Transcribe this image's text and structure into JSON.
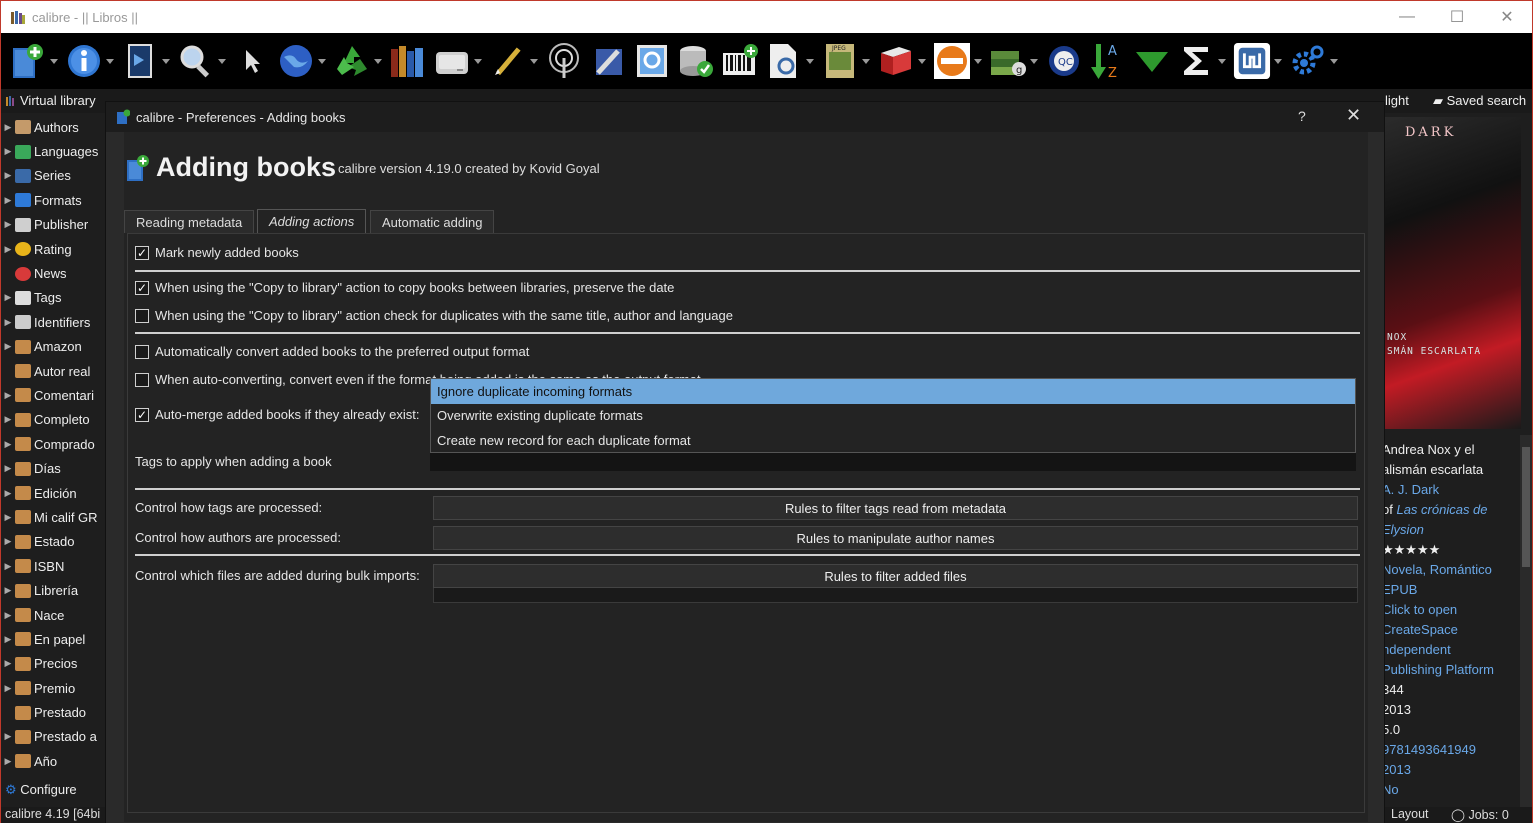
{
  "window": {
    "title": "calibre - || Libros ||",
    "min": "—",
    "max": "☐",
    "close": "✕"
  },
  "toolbar": {
    "items": [
      "add-books",
      "edit-metadata",
      "convert-books",
      "view",
      "choose-library",
      "remove-books",
      "library",
      "device",
      "edit-book",
      "fetch-news",
      "save-to-disk",
      "connect-share",
      "tweak",
      "preferences",
      "check-library",
      "barcode",
      "search-docs",
      "epub",
      "bookshelf",
      "rating",
      "goodreads",
      "quality-check",
      "sort",
      "filter",
      "sum",
      "connect",
      "settings"
    ]
  },
  "search_row": {
    "virtual_library": "Virtual library",
    "highlight": "light",
    "saved_search": "Saved search"
  },
  "tag_browser": {
    "items": [
      {
        "label": "Authors",
        "arrow": true,
        "icon": "authors-icon"
      },
      {
        "label": "Languages",
        "arrow": true,
        "icon": "languages-icon"
      },
      {
        "label": "Series",
        "arrow": true,
        "icon": "series-icon"
      },
      {
        "label": "Formats",
        "arrow": true,
        "icon": "formats-icon"
      },
      {
        "label": "Publisher",
        "arrow": true,
        "icon": "publisher-icon"
      },
      {
        "label": "Rating",
        "arrow": true,
        "icon": "rating-icon"
      },
      {
        "label": "News",
        "arrow": false,
        "icon": "news-icon"
      },
      {
        "label": "Tags",
        "arrow": true,
        "icon": "tags-icon"
      },
      {
        "label": "Identifiers",
        "arrow": true,
        "icon": "identifiers-icon"
      },
      {
        "label": "Amazon",
        "arrow": true,
        "icon": "column-icon"
      },
      {
        "label": "Autor real",
        "arrow": false,
        "icon": "column-icon"
      },
      {
        "label": "Comentari",
        "arrow": true,
        "icon": "column-icon"
      },
      {
        "label": "Completo",
        "arrow": true,
        "icon": "column-icon"
      },
      {
        "label": "Comprado",
        "arrow": true,
        "icon": "column-icon"
      },
      {
        "label": "Días",
        "arrow": true,
        "icon": "column-icon"
      },
      {
        "label": "Edición",
        "arrow": true,
        "icon": "column-icon"
      },
      {
        "label": "Mi calif GR",
        "arrow": true,
        "icon": "column-icon"
      },
      {
        "label": "Estado",
        "arrow": true,
        "icon": "column-icon"
      },
      {
        "label": "ISBN",
        "arrow": true,
        "icon": "column-icon"
      },
      {
        "label": "Librería",
        "arrow": true,
        "icon": "column-icon"
      },
      {
        "label": "Nace",
        "arrow": true,
        "icon": "column-icon"
      },
      {
        "label": "En papel",
        "arrow": true,
        "icon": "column-icon"
      },
      {
        "label": "Precios",
        "arrow": true,
        "icon": "column-icon"
      },
      {
        "label": "Premio",
        "arrow": true,
        "icon": "column-icon"
      },
      {
        "label": "Prestado",
        "arrow": false,
        "icon": "column-icon"
      },
      {
        "label": "Prestado a",
        "arrow": true,
        "icon": "column-icon"
      },
      {
        "label": "Año",
        "arrow": true,
        "icon": "column-icon"
      }
    ],
    "configure": "Configure"
  },
  "status": {
    "left": "calibre 4.19 [64bi",
    "layout": "Layout",
    "jobs": "Jobs: 0"
  },
  "book_details": {
    "cover_title": "DARK",
    "cover_subtitle": "NOX\nSMÁN ESCARLATA",
    "lines": [
      {
        "text": "Andrea Nox y el",
        "style": "white"
      },
      {
        "text": "alismán escarlata",
        "style": "white"
      },
      {
        "text": "A. J. Dark",
        "style": "link"
      },
      {
        "text": "of Las crónicas de",
        "style": "series"
      },
      {
        "text": "Elysion",
        "style": "link-italic"
      },
      {
        "text": "★★★★★",
        "style": "white"
      },
      {
        "text": "Novela, Romántico",
        "style": "link"
      },
      {
        "text": "EPUB",
        "style": "link"
      },
      {
        "text": "Click to open",
        "style": "link"
      },
      {
        "text": "CreateSpace",
        "style": "link"
      },
      {
        "text": "ndependent",
        "style": "link"
      },
      {
        "text": "Publishing Platform",
        "style": "link"
      },
      {
        "text": "344",
        "style": "white"
      },
      {
        "text": "2013",
        "style": "white"
      },
      {
        "text": "5.0",
        "style": "white"
      },
      {
        "text": "9781493641949",
        "style": "link"
      },
      {
        "text": "2013",
        "style": "link"
      },
      {
        "text": "No",
        "style": "link"
      }
    ]
  },
  "dialog": {
    "title": "calibre - Preferences - Adding books",
    "help": "?",
    "close": "✕",
    "heading": "Adding books",
    "version": "calibre version 4.19.0 created by Kovid Goyal",
    "tabs": [
      "Reading metadata",
      "Adding actions",
      "Automatic adding"
    ],
    "active_tab": "Adding actions",
    "options": {
      "mark_new": {
        "label": "Mark newly added books",
        "checked": true
      },
      "preserve_date": {
        "label": "When using the  \"Copy to library\" action to copy books between libraries, preserve the date",
        "checked": true
      },
      "check_duplicates": {
        "label": "When using the \"Copy to library\" action check for duplicates with the same title, author and language",
        "checked": false
      },
      "auto_convert": {
        "label": "Automatically convert added books to the preferred output format",
        "checked": false
      },
      "convert_even": {
        "label": "When auto-converting, convert even if the format being added is the same as the output format",
        "checked": false
      },
      "auto_merge": {
        "label": "Auto-merge added books if they already exist:",
        "checked": true
      }
    },
    "tags_label": "Tags to apply when adding a book",
    "tags_value": "",
    "rows": [
      {
        "label": "Control how tags are processed:",
        "button": "Rules to filter tags read from metadata"
      },
      {
        "label": "Control how authors are processed:",
        "button": "Rules to manipulate author names"
      },
      {
        "label": "Control which files are added during bulk imports:",
        "button": "Rules to filter added files"
      }
    ],
    "dropdown": {
      "options": [
        "Ignore duplicate incoming formats",
        "Overwrite existing duplicate formats",
        "Create new record for each duplicate format"
      ],
      "selected": "Ignore duplicate incoming formats"
    }
  },
  "colors": {
    "accent": "#6fa8dc",
    "link": "#6aa8e8",
    "window_border": "#c0392b"
  }
}
